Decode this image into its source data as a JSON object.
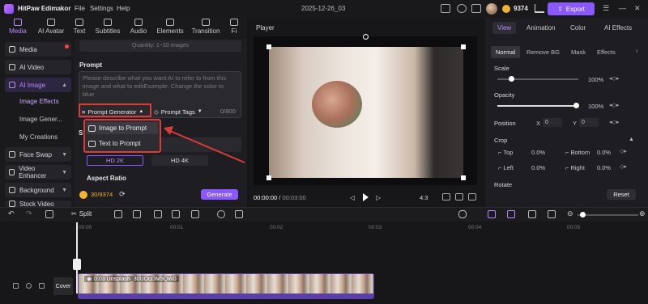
{
  "app": {
    "name": "HitPaw Edimakor",
    "project": "2025-12-26_03",
    "coins": "9374",
    "export_label": "Export",
    "menu": [
      "File",
      "Settings",
      "Help"
    ]
  },
  "tabs": [
    "Media",
    "AI Avatar",
    "Text",
    "Subtitles",
    "Audio",
    "Elements",
    "Transition",
    "Fi"
  ],
  "sidebar": {
    "items": [
      {
        "label": "Media",
        "icon": "media-icon"
      },
      {
        "label": "AI Video",
        "icon": "ai-video-icon"
      },
      {
        "label": "AI Image",
        "icon": "ai-image-icon"
      },
      {
        "label": "Face Swap",
        "icon": "face-swap-icon"
      },
      {
        "label": "Video Enhancer",
        "icon": "video-enhancer-icon"
      },
      {
        "label": "Background",
        "icon": "background-icon"
      },
      {
        "label": "Stock Video",
        "icon": "stock-video-icon"
      }
    ],
    "sub": [
      "Image Effects",
      "Image Gener...",
      "My Creations"
    ]
  },
  "panel": {
    "quantity": "Quantity: 1~10 images",
    "prompt_label": "Prompt",
    "prompt_placeholder": "Please describe what you want AI to refer to from this image and what to editExample: Change the color to blue",
    "prompt_generator": "Prompt Generator",
    "prompt_tags": "Prompt Tags",
    "count": "0/800",
    "dropdown": [
      "Image to Prompt",
      "Text to Prompt"
    ],
    "resolution": [
      "HD 2K",
      "HD 4K"
    ],
    "aspect_label": "Aspect Ratio",
    "credits": "30/9374",
    "generate": "Generate",
    "style_letter": "S"
  },
  "player": {
    "label": "Player",
    "current": "00:00:00",
    "total": "00:03:00",
    "ratio": "4:3"
  },
  "right": {
    "tabs": [
      "View",
      "Animation",
      "Color",
      "AI Effects"
    ],
    "subtabs": [
      "Normal",
      "Remove BG",
      "Mask",
      "Effects"
    ],
    "scale_label": "Scale",
    "scale_value": "100%",
    "opacity_label": "Opacity",
    "opacity_value": "100%",
    "position_label": "Position",
    "pos_x_label": "X",
    "pos_x": "0",
    "pos_y_label": "Y",
    "pos_y": "0",
    "crop_label": "Crop",
    "crop": [
      {
        "label": "Top",
        "value": "0.0%"
      },
      {
        "label": "Bottom",
        "value": "0.0%"
      },
      {
        "label": "Left",
        "value": "0.0%"
      },
      {
        "label": "Right",
        "value": "0.0%"
      }
    ],
    "rotate_label": "Rotate",
    "reset": "Reset"
  },
  "toolbar": {
    "split": "Split"
  },
  "timeline": {
    "marks": [
      "00:00",
      "00:01",
      "00:02",
      "00:03",
      "00:04",
      "00:05"
    ],
    "clip_label": "0:03 Unsplash_30UOqDM5QW0",
    "cover": "Cover"
  }
}
